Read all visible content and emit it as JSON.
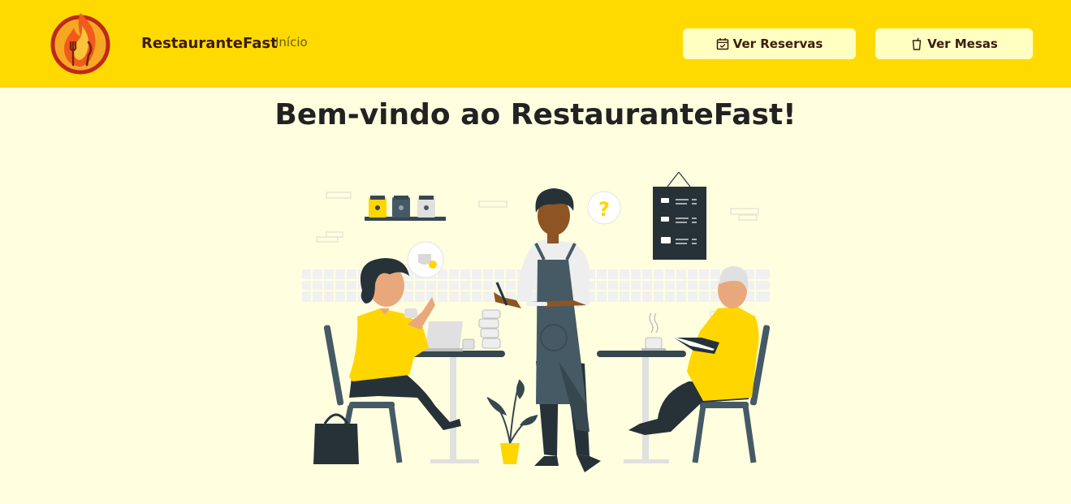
{
  "navbar": {
    "brand": "RestauranteFast",
    "links": [
      {
        "label": "Início"
      }
    ],
    "buttons": [
      {
        "label": "Ver Reservas",
        "icon": "calendar-check-icon"
      },
      {
        "label": "Ver Mesas",
        "icon": "cup-icon"
      }
    ],
    "logo": "flame-utensils-logo"
  },
  "main": {
    "heading": "Bem-vindo ao RestauranteFast!",
    "illustration": "restaurant-waiter-illustration"
  },
  "colors": {
    "navbar_bg": "#FFDA00",
    "page_bg": "#FFFFE0",
    "button_bg": "#FFFFC2",
    "text_dark": "#3a1d0c",
    "accent_yellow": "#FFD600",
    "illustration_dark": "#37474F"
  }
}
